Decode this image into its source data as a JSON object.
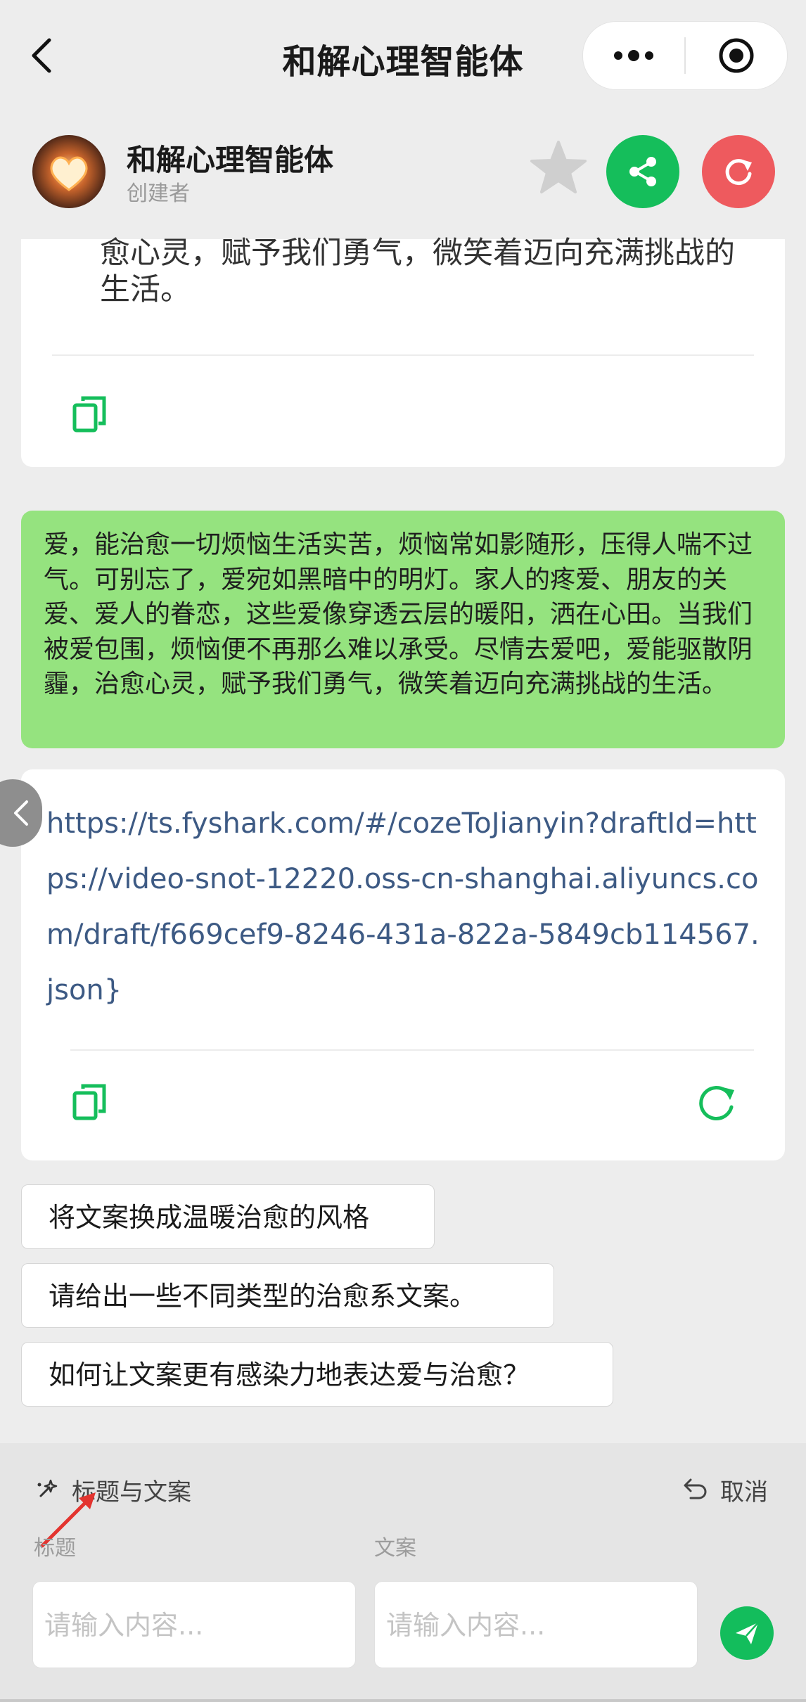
{
  "nav": {
    "title": "和解心理智能体"
  },
  "bot": {
    "name": "和解心理智能体",
    "subtitle": "创建者"
  },
  "colors": {
    "green": "#15be5b",
    "red": "#ee5a5e",
    "bubble": "#95e37f",
    "link": "#3d5a84"
  },
  "messages": {
    "previous_tail": "愈心灵，赋予我们勇气，微笑着迈向充满挑战的生活。",
    "user_bubble": "爱，能治愈一切烦恼生活实苦，烦恼常如影随形，压得人喘不过气。可别忘了，爱宛如黑暗中的明灯。家人的疼爱、朋友的关爱、爱人的眷恋，这些爱像穿透云层的暖阳，洒在心田。当我们被爱包围，烦恼便不再那么难以承受。尽情去爱吧，爱能驱散阴霾，治愈心灵，赋予我们勇气，微笑着迈向充满挑战的生活。",
    "link_reply": "https://ts.fyshark.com/#/cozeToJianyin?draftId=https://video-snot-12220.oss-cn-shanghai.aliyuncs.com/draft/f669cef9-8246-431a-822a-5849cb114567.json}"
  },
  "suggestions": [
    "将文案换成温暖治愈的风格",
    "请给出一些不同类型的治愈系文案。",
    "如何让文案更有感染力地表达爱与治愈？"
  ],
  "panel": {
    "title": "标题与文案",
    "cancel": "取消",
    "title_label": "标题",
    "copy_label": "文案",
    "title_placeholder": "请输入内容...",
    "copy_placeholder": "请输入内容..."
  }
}
